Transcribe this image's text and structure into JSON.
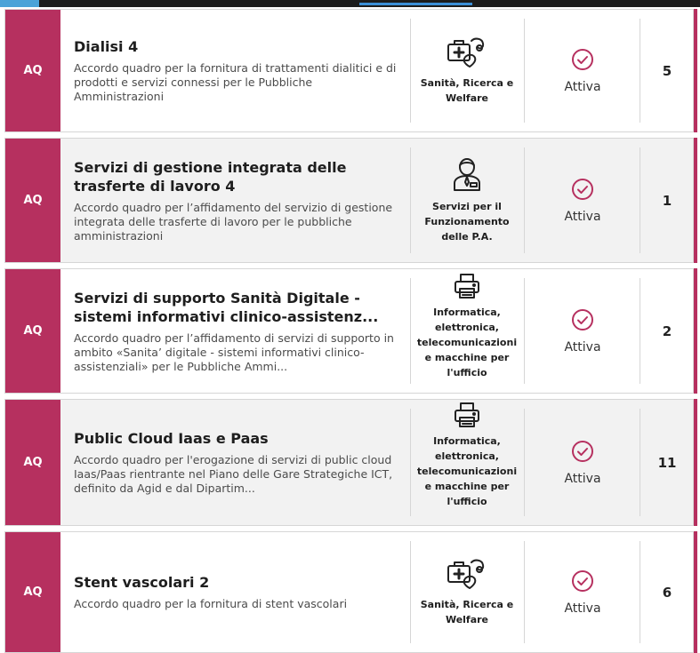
{
  "colors": {
    "accent": "#b6305f",
    "shade": "#f2f2f2",
    "border": "#d6d6d6"
  },
  "rows": [
    {
      "badge": "AQ",
      "title": "Dialisi 4",
      "description": "Accordo quadro per la fornitura di trattamenti dialitici e di prodotti e servizi connessi per le Pubbliche Amministrazioni",
      "category": "Sanità, Ricerca e Welfare",
      "category_icon": "medical-kit-icon",
      "status": "Attiva",
      "count": "5"
    },
    {
      "badge": "AQ",
      "title": "Servizi di gestione integrata delle trasferte di lavoro 4",
      "description": "Accordo quadro per l’affidamento del servizio di gestione integrata delle trasferte di lavoro per le pubbliche amministrazioni",
      "category": "Servizi per il Funzionamento delle P.A.",
      "category_icon": "employee-icon",
      "status": "Attiva",
      "count": "1"
    },
    {
      "badge": "AQ",
      "title": "Servizi di supporto Sanità Digitale - sistemi informativi clinico-assistenz...",
      "description": "Accordo quadro per l’affidamento di servizi di supporto in ambito «Sanita’ digitale - sistemi informativi clinico-assistenziali» per le Pubbliche Ammi...",
      "category": "Informatica, elettronica, telecomunicazioni e macchine per l'ufficio",
      "category_icon": "printer-icon",
      "status": "Attiva",
      "count": "2"
    },
    {
      "badge": "AQ",
      "title": "Public Cloud Iaas e Paas",
      "description": "Accordo quadro per l'erogazione di servizi di public cloud Iaas/Paas rientrante nel Piano delle Gare Strategiche ICT, definito da Agid e dal Dipartim...",
      "category": "Informatica, elettronica, telecomunicazioni e macchine per l'ufficio",
      "category_icon": "printer-icon",
      "status": "Attiva",
      "count": "11"
    },
    {
      "badge": "AQ",
      "title": "Stent vascolari 2",
      "description": "Accordo quadro per la fornitura di stent vascolari",
      "category": "Sanità, Ricerca e Welfare",
      "category_icon": "medical-kit-icon",
      "status": "Attiva",
      "count": "6"
    }
  ]
}
